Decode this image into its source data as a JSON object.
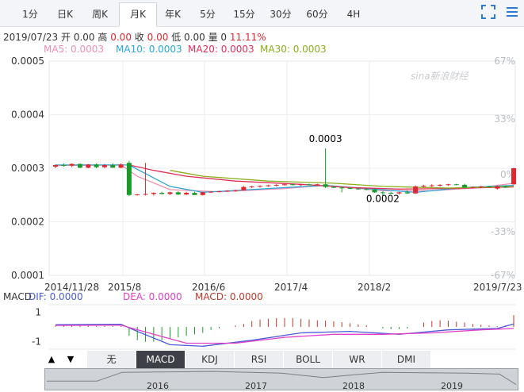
{
  "tabs": [
    {
      "label": "1分",
      "active": false
    },
    {
      "label": "日K",
      "active": false
    },
    {
      "label": "周K",
      "active": false
    },
    {
      "label": "月K",
      "active": true
    },
    {
      "label": "年K",
      "active": false
    },
    {
      "label": "5分",
      "active": false
    },
    {
      "label": "15分",
      "active": false
    },
    {
      "label": "30分",
      "active": false
    },
    {
      "label": "60分",
      "active": false
    },
    {
      "label": "4H",
      "active": false
    }
  ],
  "ohlc": {
    "date": "2019/07/23",
    "open_label": "开",
    "open": "0.00",
    "high_label": "高",
    "high": "0.00",
    "close_label": "收",
    "close": "0.00",
    "low_label": "低",
    "low": "0.00",
    "volume_label": "量",
    "volume": "0",
    "change": "11.11%"
  },
  "ma_legend": [
    {
      "label": "MA5: 0.0003",
      "color": "#f08fb0"
    },
    {
      "label": "MA10: 0.0003",
      "color": "#2aa7d8"
    },
    {
      "label": "MA20: 0.0003",
      "color": "#e0305a"
    },
    {
      "label": "MA30: 0.0003",
      "color": "#8aae1c"
    }
  ],
  "watermark": "sina新浪财经",
  "macd_legend": {
    "title": "MACD",
    "dif": {
      "label": "DIF: 0.0000",
      "color": "#4a5bd6"
    },
    "dea": {
      "label": "DEA: 0.0000",
      "color": "#e040c8"
    },
    "macd": {
      "label": "MACD: 0.0000",
      "color": "#c0392b"
    }
  },
  "indicator_tabs": [
    {
      "label": "无",
      "active": false
    },
    {
      "label": "MACD",
      "active": true
    },
    {
      "label": "KDJ",
      "active": false
    },
    {
      "label": "RSI",
      "active": false
    },
    {
      "label": "BOLL",
      "active": false
    },
    {
      "label": "WR",
      "active": false
    },
    {
      "label": "DMI",
      "active": false
    }
  ],
  "arrows": {
    "up": "▲",
    "down": "▼"
  },
  "navigator_labels": [
    "2016",
    "2017",
    "2018",
    "2019"
  ],
  "colors": {
    "up": "#e0262f",
    "down": "#1a9a2a"
  },
  "chart_data": {
    "type": "candlestick",
    "y_left_ticks": [
      "0.0005",
      "0.0004",
      "0.0003",
      "0.0002",
      "0.0001"
    ],
    "y_right_ticks": [
      "67%",
      "33%",
      "0%",
      "-33%",
      "-67%"
    ],
    "x_ticks": [
      "2014/11/28",
      "2015/8",
      "2016/6",
      "2017/4",
      "2018/2",
      "2019/7/23"
    ],
    "ylim": [
      0.0001,
      0.0005
    ],
    "annotations": [
      {
        "text": "0.0003",
        "month": 33,
        "value": 0.000337
      },
      {
        "text": "0.0002",
        "month": 40,
        "value": 0.000255
      }
    ],
    "candles": [
      {
        "m": 0,
        "o": 0.000303,
        "h": 0.000307,
        "l": 0.0003,
        "c": 0.000306
      },
      {
        "m": 1,
        "o": 0.000306,
        "h": 0.000309,
        "l": 0.000303,
        "c": 0.000305
      },
      {
        "m": 2,
        "o": 0.000305,
        "h": 0.000309,
        "l": 0.000302,
        "c": 0.000308
      },
      {
        "m": 3,
        "o": 0.000308,
        "h": 0.000309,
        "l": 0.0003,
        "c": 0.000301
      },
      {
        "m": 4,
        "o": 0.000301,
        "h": 0.000308,
        "l": 0.0003,
        "c": 0.000307
      },
      {
        "m": 5,
        "o": 0.000307,
        "h": 0.000309,
        "l": 0.0003,
        "c": 0.000302
      },
      {
        "m": 6,
        "o": 0.000302,
        "h": 0.000308,
        "l": 0.0003,
        "c": 0.000306
      },
      {
        "m": 7,
        "o": 0.000306,
        "h": 0.000309,
        "l": 0.000301,
        "c": 0.000301
      },
      {
        "m": 8,
        "o": 0.000301,
        "h": 0.000309,
        "l": 0.0003,
        "c": 0.000307
      },
      {
        "m": 9,
        "o": 0.00031,
        "h": 0.000314,
        "l": 0.000248,
        "c": 0.00025
      },
      {
        "m": 10,
        "o": 0.00025,
        "h": 0.000252,
        "l": 0.000249,
        "c": 0.000251
      },
      {
        "m": 11,
        "o": 0.000251,
        "h": 0.00031,
        "l": 0.000249,
        "c": 0.000252
      },
      {
        "m": 12,
        "o": 0.000252,
        "h": 0.000255,
        "l": 0.000249,
        "c": 0.000254
      },
      {
        "m": 13,
        "o": 0.000254,
        "h": 0.000256,
        "l": 0.000251,
        "c": 0.000252
      },
      {
        "m": 14,
        "o": 0.000252,
        "h": 0.000256,
        "l": 0.00025,
        "c": 0.000255
      },
      {
        "m": 15,
        "o": 0.000255,
        "h": 0.000257,
        "l": 0.00025,
        "c": 0.000251
      },
      {
        "m": 16,
        "o": 0.000251,
        "h": 0.000256,
        "l": 0.00025,
        "c": 0.000254
      },
      {
        "m": 17,
        "o": 0.000254,
        "h": 0.000256,
        "l": 0.00025,
        "c": 0.00025
      },
      {
        "m": 18,
        "o": 0.00025,
        "h": 0.000256,
        "l": 0.000249,
        "c": 0.000255
      },
      {
        "m": 19,
        "o": 0.000255,
        "h": 0.000257,
        "l": 0.000254,
        "c": 0.000256
      },
      {
        "m": 20,
        "o": 0.000256,
        "h": 0.000258,
        "l": 0.000255,
        "c": 0.000257
      },
      {
        "m": 21,
        "o": 0.000257,
        "h": 0.000259,
        "l": 0.000256,
        "c": 0.000258
      },
      {
        "m": 22,
        "o": 0.000258,
        "h": 0.00026,
        "l": 0.000256,
        "c": 0.000259
      },
      {
        "m": 23,
        "o": 0.000259,
        "h": 0.000267,
        "l": 0.000258,
        "c": 0.000265
      },
      {
        "m": 24,
        "o": 0.000265,
        "h": 0.000267,
        "l": 0.000263,
        "c": 0.000266
      },
      {
        "m": 25,
        "o": 0.000266,
        "h": 0.000268,
        "l": 0.000264,
        "c": 0.000267
      },
      {
        "m": 26,
        "o": 0.000267,
        "h": 0.000269,
        "l": 0.000265,
        "c": 0.000268
      },
      {
        "m": 27,
        "o": 0.000268,
        "h": 0.00027,
        "l": 0.000266,
        "c": 0.000269
      },
      {
        "m": 28,
        "o": 0.000269,
        "h": 0.000271,
        "l": 0.000267,
        "c": 0.00027
      },
      {
        "m": 29,
        "o": 0.00027,
        "h": 0.000271,
        "l": 0.000268,
        "c": 0.000269
      },
      {
        "m": 30,
        "o": 0.000269,
        "h": 0.000271,
        "l": 0.000267,
        "c": 0.00027
      },
      {
        "m": 31,
        "o": 0.00027,
        "h": 0.000271,
        "l": 0.000268,
        "c": 0.000269
      },
      {
        "m": 32,
        "o": 0.000269,
        "h": 0.000271,
        "l": 0.000267,
        "c": 0.00027
      },
      {
        "m": 33,
        "o": 0.00027,
        "h": 0.000337,
        "l": 0.000263,
        "c": 0.000265
      },
      {
        "m": 34,
        "o": 0.000265,
        "h": 0.000267,
        "l": 0.000263,
        "c": 0.000264
      },
      {
        "m": 35,
        "o": 0.000264,
        "h": 0.000266,
        "l": 0.000255,
        "c": 0.000263
      },
      {
        "m": 36,
        "o": 0.000263,
        "h": 0.000265,
        "l": 0.000261,
        "c": 0.000262
      },
      {
        "m": 37,
        "o": 0.000262,
        "h": 0.000264,
        "l": 0.00026,
        "c": 0.000261
      },
      {
        "m": 38,
        "o": 0.000261,
        "h": 0.000263,
        "l": 0.000259,
        "c": 0.00026
      },
      {
        "m": 39,
        "o": 0.00026,
        "h": 0.000262,
        "l": 0.000254,
        "c": 0.000255
      },
      {
        "m": 40,
        "o": 0.000255,
        "h": 0.000257,
        "l": 0.000248,
        "c": 0.000254
      },
      {
        "m": 41,
        "o": 0.000254,
        "h": 0.000256,
        "l": 0.000252,
        "c": 0.000253
      },
      {
        "m": 42,
        "o": 0.000253,
        "h": 0.000256,
        "l": 0.000251,
        "c": 0.000255
      },
      {
        "m": 43,
        "o": 0.000255,
        "h": 0.000259,
        "l": 0.000252,
        "c": 0.000253
      },
      {
        "m": 44,
        "o": 0.000253,
        "h": 0.000268,
        "l": 0.000252,
        "c": 0.000266
      },
      {
        "m": 45,
        "o": 0.000266,
        "h": 0.000269,
        "l": 0.000264,
        "c": 0.000267
      },
      {
        "m": 46,
        "o": 0.000267,
        "h": 0.00027,
        "l": 0.000265,
        "c": 0.000268
      },
      {
        "m": 47,
        "o": 0.000268,
        "h": 0.00027,
        "l": 0.000266,
        "c": 0.000269
      },
      {
        "m": 48,
        "o": 0.000269,
        "h": 0.000271,
        "l": 0.000267,
        "c": 0.00027
      },
      {
        "m": 49,
        "o": 0.00027,
        "h": 0.000271,
        "l": 0.000268,
        "c": 0.000269
      },
      {
        "m": 50,
        "o": 0.000269,
        "h": 0.000271,
        "l": 0.000262,
        "c": 0.000264
      },
      {
        "m": 51,
        "o": 0.000264,
        "h": 0.000266,
        "l": 0.000262,
        "c": 0.000265
      },
      {
        "m": 52,
        "o": 0.000265,
        "h": 0.000267,
        "l": 0.000263,
        "c": 0.000266
      },
      {
        "m": 53,
        "o": 0.000266,
        "h": 0.000267,
        "l": 0.000264,
        "c": 0.000265
      },
      {
        "m": 54,
        "o": 0.000262,
        "h": 0.000268,
        "l": 0.00026,
        "c": 0.000266
      },
      {
        "m": 55,
        "o": 0.000266,
        "h": 0.000268,
        "l": 0.000263,
        "c": 0.000264
      },
      {
        "m": 56,
        "o": 0.00027,
        "h": 0.000301,
        "l": 0.000269,
        "c": 0.0003
      }
    ],
    "ma_series": [
      {
        "name": "MA5",
        "color": "#f08fb0",
        "points": [
          [
            0,
            0.000305
          ],
          [
            8,
            0.000306
          ],
          [
            10,
            0.000285
          ],
          [
            14,
            0.00026
          ],
          [
            20,
            0.000256
          ],
          [
            28,
            0.000262
          ],
          [
            33,
            0.000268
          ],
          [
            40,
            0.000258
          ],
          [
            46,
            0.000258
          ],
          [
            52,
            0.000264
          ],
          [
            56,
            0.000272
          ]
        ]
      },
      {
        "name": "MA10",
        "color": "#2aa7d8",
        "points": [
          [
            0,
            0.000306
          ],
          [
            9,
            0.000306
          ],
          [
            11,
            0.00029
          ],
          [
            14,
            0.000266
          ],
          [
            18,
            0.000255
          ],
          [
            26,
            0.000262
          ],
          [
            33,
            0.000268
          ],
          [
            38,
            0.000262
          ],
          [
            44,
            0.000255
          ],
          [
            50,
            0.000264
          ],
          [
            56,
            0.000268
          ]
        ]
      },
      {
        "name": "MA20",
        "color": "#e0305a",
        "points": [
          [
            9,
            0.000306
          ],
          [
            12,
            0.000296
          ],
          [
            16,
            0.000285
          ],
          [
            22,
            0.000276
          ],
          [
            30,
            0.00027
          ],
          [
            36,
            0.000264
          ],
          [
            42,
            0.000261
          ],
          [
            48,
            0.000262
          ],
          [
            56,
            0.000265
          ]
        ]
      },
      {
        "name": "MA30",
        "color": "#8aae1c",
        "points": [
          [
            14,
            0.000296
          ],
          [
            18,
            0.000285
          ],
          [
            26,
            0.000276
          ],
          [
            34,
            0.000272
          ],
          [
            40,
            0.000266
          ],
          [
            48,
            0.000263
          ],
          [
            56,
            0.000266
          ]
        ]
      }
    ],
    "macd_ylim": [
      -1.5,
      1.5
    ],
    "macd_ticks": [
      "1",
      "-1"
    ],
    "macd_hist": [
      0.08,
      0.08,
      0.08,
      0.07,
      0.07,
      0.06,
      0.06,
      0.05,
      0.05,
      -0.6,
      -0.9,
      -1.0,
      -1.0,
      -0.9,
      -0.8,
      -0.7,
      -0.6,
      -0.5,
      -0.4,
      -0.2,
      -0.1,
      0.0,
      0.1,
      0.2,
      0.4,
      0.5,
      0.55,
      0.6,
      0.6,
      0.6,
      0.55,
      0.5,
      0.45,
      0.42,
      0.38,
      0.32,
      0.25,
      0.18,
      0.1,
      0.0,
      -0.1,
      -0.15,
      -0.15,
      -0.1,
      0.0,
      0.3,
      0.4,
      0.45,
      0.42,
      0.35,
      0.3,
      0.2,
      0.15,
      0.1,
      0.05,
      0.1,
      0.8
    ],
    "macd_dif": [
      [
        0,
        0.15
      ],
      [
        8,
        0.18
      ],
      [
        10,
        -0.3
      ],
      [
        14,
        -1.2
      ],
      [
        18,
        -1.3
      ],
      [
        24,
        -0.9
      ],
      [
        30,
        -0.4
      ],
      [
        36,
        -0.3
      ],
      [
        42,
        -0.5
      ],
      [
        48,
        -0.2
      ],
      [
        54,
        -0.1
      ],
      [
        56,
        0.2
      ]
    ],
    "macd_dea": [
      [
        0,
        0.1
      ],
      [
        8,
        0.12
      ],
      [
        12,
        -0.5
      ],
      [
        16,
        -1.1
      ],
      [
        22,
        -1.1
      ],
      [
        28,
        -0.7
      ],
      [
        34,
        -0.5
      ],
      [
        40,
        -0.5
      ],
      [
        46,
        -0.4
      ],
      [
        52,
        -0.2
      ],
      [
        56,
        -0.1
      ]
    ],
    "navigator_series": [
      [
        0,
        0.4
      ],
      [
        6,
        0.4
      ],
      [
        9,
        0.9
      ],
      [
        20,
        0.95
      ],
      [
        28,
        0.85
      ],
      [
        33,
        0.6
      ],
      [
        40,
        0.9
      ],
      [
        50,
        0.85
      ],
      [
        54,
        0.8
      ],
      [
        56,
        0.2
      ]
    ]
  }
}
